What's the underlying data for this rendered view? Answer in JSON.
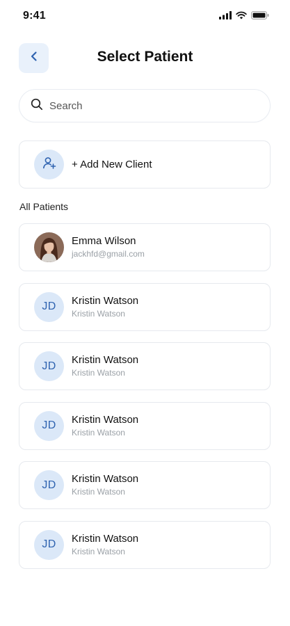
{
  "status_bar": {
    "time": "9:41"
  },
  "header": {
    "title": "Select Patient"
  },
  "search": {
    "placeholder": "Search"
  },
  "add_client": {
    "label": "+ Add New Client"
  },
  "section": {
    "label": "All Patients"
  },
  "patients": [
    {
      "name": "Emma Wilson",
      "sub": "jackhfd@gmail.com",
      "avatar": "photo"
    },
    {
      "name": "Kristin Watson",
      "sub": "Kristin Watson",
      "initials": "JD"
    },
    {
      "name": "Kristin Watson",
      "sub": "Kristin Watson",
      "initials": "JD"
    },
    {
      "name": "Kristin Watson",
      "sub": "Kristin Watson",
      "initials": "JD"
    },
    {
      "name": "Kristin Watson",
      "sub": "Kristin Watson",
      "initials": "JD"
    },
    {
      "name": "Kristin Watson",
      "sub": "Kristin Watson",
      "initials": "JD"
    }
  ],
  "icons": {
    "back": "chevron-left-icon",
    "search": "search-icon",
    "add_user": "user-plus-icon",
    "signal": "cellular-signal-icon",
    "wifi": "wifi-icon",
    "battery": "battery-icon"
  },
  "colors": {
    "accent": "#2f63b0",
    "avatar_bg": "#dbe8f8",
    "back_bg": "#e9f1fb",
    "border": "#e6e9ee",
    "muted_text": "#9aa0a6"
  }
}
